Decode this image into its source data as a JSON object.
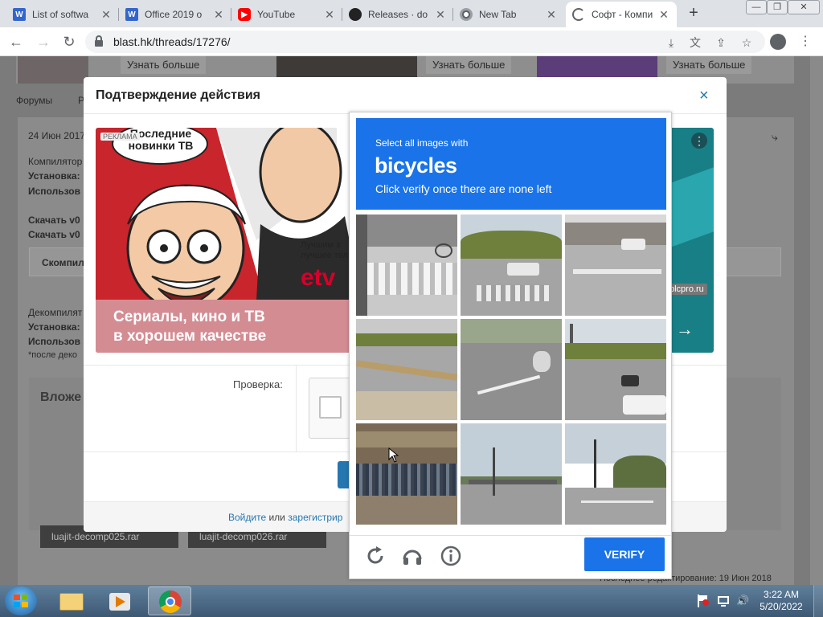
{
  "browser": {
    "tabs": [
      {
        "title": "List of softwa",
        "favicon": "wiki-icon",
        "active": false
      },
      {
        "title": "Office 2019 o",
        "favicon": "wiki-icon",
        "active": false
      },
      {
        "title": "YouTube",
        "favicon": "youtube-icon",
        "active": false
      },
      {
        "title": "Releases · do",
        "favicon": "github-icon",
        "active": false
      },
      {
        "title": "New Tab",
        "favicon": "chrome-icon",
        "active": false
      },
      {
        "title": "Софт - Компи",
        "favicon": "loading-icon",
        "active": true
      }
    ],
    "new_tab_symbol": "+",
    "url": "blast.hk/threads/17276/"
  },
  "page": {
    "promo_button": "Узнать больше",
    "breadcrumb_first": "Форумы",
    "breadcrumb_rest": "Р",
    "post_date": "24 Июн 2017",
    "lines": [
      "Компилятор",
      "Установка:",
      "Использов",
      "Скачать v0",
      "Скачать v0",
      "Скомпил",
      "Декомпилят",
      "Установка:",
      "Использов",
      "*после деко"
    ],
    "attachments_heading": "Вложе",
    "attachments": [
      "luajit-decomp025.rar",
      "luajit-decomp026.rar"
    ],
    "last_edited": "Последнее редактирование: 19 Июн 2018"
  },
  "dialog": {
    "title": "Подтверждение действия",
    "close": "×",
    "ad": {
      "label": "РЕКЛАМА",
      "bubble": "Последние новинки ТВ",
      "tagline_line1": "Лучшим з",
      "tagline_line2": "лучшее тел",
      "brand": "etv",
      "caption_line1": "Сериалы, кино и ТВ",
      "caption_line2": "в хорошем качестве"
    },
    "ad2": {
      "domain": "plcpro.ru",
      "arrow": "→",
      "menu": "⋮"
    },
    "check_label": "Проверка:",
    "footer": {
      "login": "Войдите",
      "or": "или",
      "register": "зарегистрир"
    }
  },
  "captcha": {
    "line1": "Select all images with",
    "keyword": "bicycles",
    "line2": "Click verify once there are none left",
    "verify": "VERIFY",
    "colors": {
      "accent": "#1a73e8"
    }
  },
  "taskbar": {
    "time": "3:22 AM",
    "date": "5/20/2022"
  }
}
